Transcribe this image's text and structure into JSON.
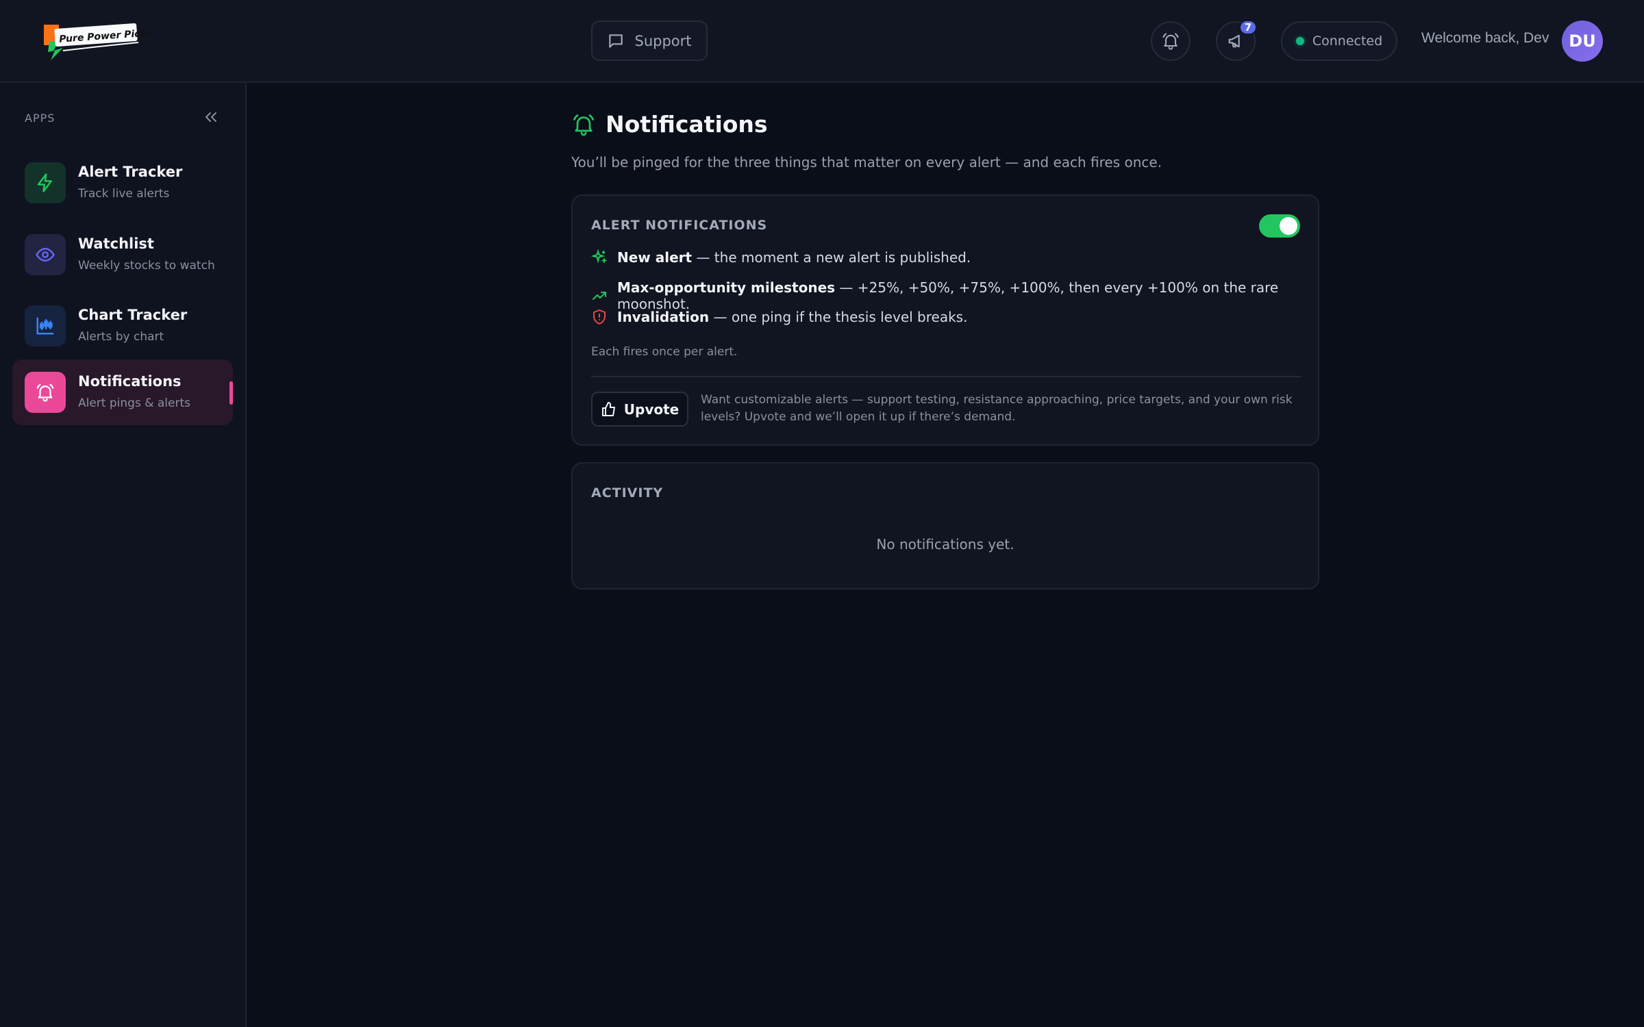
{
  "header": {
    "logo_text": "Pure Power Picks",
    "support_label": "Support",
    "announcements_badge": "7",
    "connection_status": "Connected",
    "welcome_text": "Welcome back, Dev",
    "avatar_initials": "DU"
  },
  "sidebar": {
    "section_label": "APPS",
    "items": [
      {
        "title": "Alert Tracker",
        "subtitle": "Track live alerts",
        "icon": "lightning-icon",
        "color": "#22c55e"
      },
      {
        "title": "Watchlist",
        "subtitle": "Weekly stocks to watch",
        "icon": "eye-icon",
        "color": "#6366f1"
      },
      {
        "title": "Chart Tracker",
        "subtitle": "Alerts by chart",
        "icon": "chart-icon",
        "color": "#3b82f6"
      },
      {
        "title": "Notifications",
        "subtitle": "Alert pings & alerts",
        "icon": "bell-icon",
        "color": "#ec4899",
        "active": true
      }
    ]
  },
  "main": {
    "title": "Notifications",
    "description": "You’ll be pinged for the three things that matter on every alert — and each fires once.",
    "alert_card": {
      "title": "ALERT NOTIFICATIONS",
      "enabled": true,
      "features": [
        {
          "name": "New alert",
          "text": " — the moment a new alert is published.",
          "icon": "sparkle-icon",
          "color": "#22c55e"
        },
        {
          "name": "Max-opportunity milestones",
          "text": " — +25%, +50%, +75%, +100%, then every +100% on the rare moonshot.",
          "icon": "trend-up-icon",
          "color": "#22c55e"
        },
        {
          "name": "Invalidation",
          "text": " — one ping if the thesis level breaks.",
          "icon": "shield-alert-icon",
          "color": "#ef4444"
        }
      ],
      "note": "Each fires once per alert.",
      "upvote_label": "Upvote",
      "upvote_text": "Want customizable alerts — support testing, resistance approaching, price targets, and your own risk levels? Upvote and we’ll open it up if there’s demand."
    },
    "activity_card": {
      "title": "ACTIVITY",
      "empty_text": "No notifications yet."
    }
  }
}
